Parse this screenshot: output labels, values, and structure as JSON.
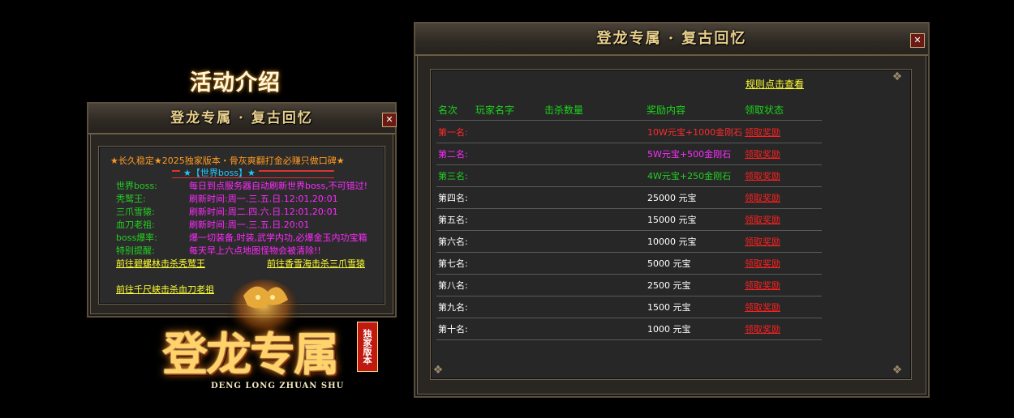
{
  "left": {
    "heading": "活动介绍",
    "panel_title": "登龙专属 · 复古回忆",
    "close": "✕",
    "banner": "★长久稳定★2025独家版本・骨灰爽翻打金必赚只做口碑★",
    "section": "★【世界boss】★",
    "rows": [
      {
        "label": "世界boss:",
        "value": "每日到点服务器自动刷新世界boss,不可错过!"
      },
      {
        "label": "秃鹫王:",
        "value": "刷新时间:周一.三.五.日.12:01,20:01"
      },
      {
        "label": "三爪雪猿:",
        "value": "刷新时间:周二.四.六.日.12:01,20:01"
      },
      {
        "label": "血刀老祖:",
        "value": "刷新时间:周一.三.五.日.20:01"
      },
      {
        "label": "boss爆率:",
        "value": "爆一切装备,时装,武学内功,必爆金玉内功宝箱"
      },
      {
        "label": "特别提醒:",
        "value": "每天早上六点地图怪物会被清除!!"
      }
    ],
    "links": [
      "前往碧螺林击杀秃鹫王",
      "前往香雪海击杀三爪雪猿",
      "前往千尺峡击杀血刀老祖"
    ]
  },
  "logo": {
    "main": "登龙专属",
    "badge": "独家版本",
    "pinyin": "DENG LONG ZHUAN SHU"
  },
  "right": {
    "panel_title": "登龙专属 · 复古回忆",
    "close": "✕",
    "rules_link": "规则点击查看",
    "headers": [
      "名次",
      "玩家名字",
      "击杀数量",
      "奖励内容",
      "领取状态"
    ],
    "rows": [
      {
        "rank": "第一名:",
        "player": "",
        "kills": "",
        "reward": "10W元宝+1000金刚石",
        "claim": "领取奖励",
        "color": "#ff2b2b"
      },
      {
        "rank": "第二名:",
        "player": "",
        "kills": "",
        "reward": "5W元宝+500金刚石",
        "claim": "领取奖励",
        "color": "#ff2bff"
      },
      {
        "rank": "第三名:",
        "player": "",
        "kills": "",
        "reward": "4W元宝+250金刚石",
        "claim": "领取奖励",
        "color": "#22d022"
      },
      {
        "rank": "第四名:",
        "player": "",
        "kills": "",
        "reward": "25000  元宝",
        "claim": "领取奖励",
        "color": "#ffffff"
      },
      {
        "rank": "第五名:",
        "player": "",
        "kills": "",
        "reward": "15000  元宝",
        "claim": "领取奖励",
        "color": "#ffffff"
      },
      {
        "rank": "第六名:",
        "player": "",
        "kills": "",
        "reward": "10000  元宝",
        "claim": "领取奖励",
        "color": "#ffffff"
      },
      {
        "rank": "第七名:",
        "player": "",
        "kills": "",
        "reward": "5000  元宝",
        "claim": "领取奖励",
        "color": "#ffffff"
      },
      {
        "rank": "第八名:",
        "player": "",
        "kills": "",
        "reward": "2500    元宝",
        "claim": "领取奖励",
        "color": "#ffffff"
      },
      {
        "rank": "第九名:",
        "player": "",
        "kills": "",
        "reward": "1500    元宝",
        "claim": "领取奖励",
        "color": "#ffffff"
      },
      {
        "rank": "第十名:",
        "player": "",
        "kills": "",
        "reward": "1000    元宝",
        "claim": "领取奖励",
        "color": "#ffffff"
      }
    ]
  }
}
